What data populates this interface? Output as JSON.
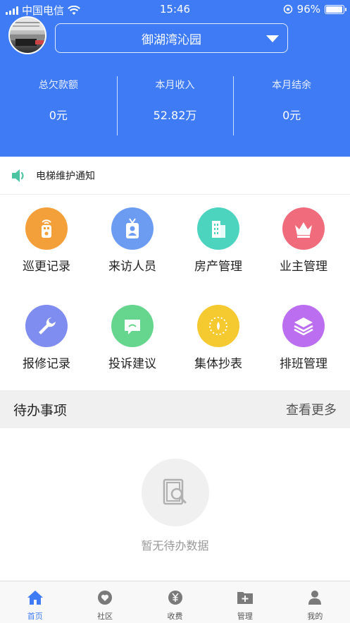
{
  "status_bar": {
    "carrier": "中国电信",
    "time": "15:46",
    "battery": "96%",
    "battery_level": 0.96
  },
  "header": {
    "community": "御湖湾沁园",
    "stats": [
      {
        "label": "总欠款额",
        "value": "0元"
      },
      {
        "label": "本月收入",
        "value": "52.82万"
      },
      {
        "label": "本月结余",
        "value": "0元"
      }
    ]
  },
  "notice": {
    "icon": "speaker-icon",
    "text": "电梯维护通知",
    "color": "#4cc4a3"
  },
  "grid": [
    {
      "label": "巡更记录",
      "icon": "patrol-device-icon",
      "color": "#f3a03a"
    },
    {
      "label": "来访人员",
      "icon": "visitor-badge-icon",
      "color": "#6b9cf2"
    },
    {
      "label": "房产管理",
      "icon": "building-icon",
      "color": "#4dd4bf"
    },
    {
      "label": "业主管理",
      "icon": "crown-icon",
      "color": "#f06b7c"
    },
    {
      "label": "报修记录",
      "icon": "wrench-icon",
      "color": "#7f8cf0"
    },
    {
      "label": "投诉建议",
      "icon": "message-icon",
      "color": "#66d68f"
    },
    {
      "label": "集体抄表",
      "icon": "meter-icon",
      "color": "#f5c930"
    },
    {
      "label": "排班管理",
      "icon": "layers-icon",
      "color": "#bb6ef0"
    }
  ],
  "pending": {
    "title": "待办事项",
    "more": "查看更多",
    "empty_text": "暂无待办数据"
  },
  "tabbar": [
    {
      "label": "首页",
      "icon": "home-icon",
      "active": true
    },
    {
      "label": "社区",
      "icon": "community-icon",
      "active": false
    },
    {
      "label": "收费",
      "icon": "yuan-icon",
      "active": false
    },
    {
      "label": "管理",
      "icon": "folder-add-icon",
      "active": false
    },
    {
      "label": "我的",
      "icon": "user-icon",
      "active": false
    }
  ],
  "colors": {
    "primary": "#3f7bf5",
    "tab_active": "#3f7bf5",
    "tab_inactive": "#7a7a7a"
  }
}
